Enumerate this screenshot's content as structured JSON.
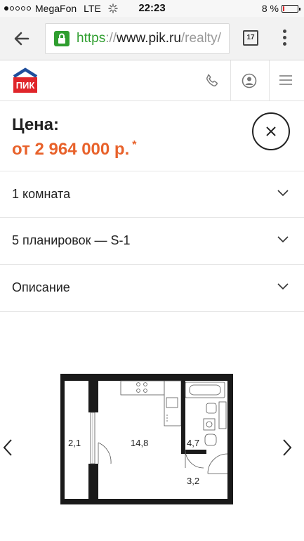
{
  "status_bar": {
    "carrier": "MegaFon",
    "network": "LTE",
    "time": "22:23",
    "battery": "8 %"
  },
  "browser": {
    "url_scheme": "https",
    "url_separator": "://",
    "url_host": "www.pik.ru",
    "url_path": "/realty/",
    "tab_count": "17"
  },
  "header": {
    "logo_text": "ПИК"
  },
  "price": {
    "title": "Цена:",
    "value": "от 2 964 000 р.",
    "footnote_mark": "*"
  },
  "accordion": [
    {
      "label": "1 комната"
    },
    {
      "label": "5 планировок — S-1"
    },
    {
      "label": "Описание"
    }
  ],
  "plan": {
    "rooms": {
      "balcony": "2,1",
      "living": "14,8",
      "bathroom": "4,7",
      "hall": "3,2"
    }
  },
  "colors": {
    "accent": "#e8622b",
    "logo_blue": "#1f4e9c",
    "logo_red": "#e0252a",
    "secure_green": "#2f9e2f"
  }
}
